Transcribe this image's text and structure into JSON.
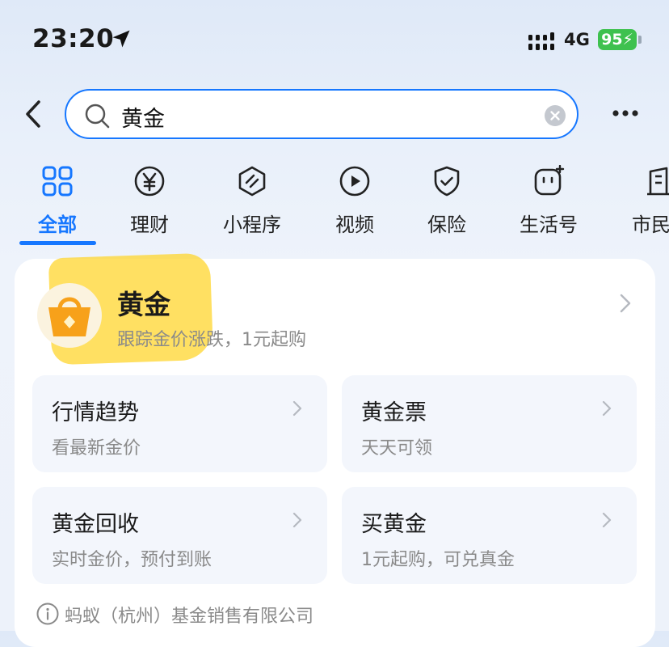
{
  "status_bar": {
    "time": "23:20",
    "network": "4G",
    "battery": "95"
  },
  "search": {
    "query": "黄金"
  },
  "tabs": [
    {
      "label": "全部",
      "icon": "grid-icon",
      "active": true
    },
    {
      "label": "理财",
      "icon": "yen-coin-icon"
    },
    {
      "label": "小程序",
      "icon": "mini-program-icon"
    },
    {
      "label": "视频",
      "icon": "play-icon"
    },
    {
      "label": "保险",
      "icon": "shield-check-icon"
    },
    {
      "label": "生活号",
      "icon": "life-account-icon"
    },
    {
      "label": "市民",
      "icon": "building-icon"
    }
  ],
  "product": {
    "title": "黄金",
    "subtitle": "跟踪金价涨跌，1元起购",
    "logo_icon": "gold-basket-icon",
    "accent_color": "#f7a11a"
  },
  "tiles": [
    {
      "title": "行情趋势",
      "subtitle": "看最新金价"
    },
    {
      "title": "黄金票",
      "subtitle": "天天可领"
    },
    {
      "title": "黄金回收",
      "subtitle": "实时金价，预付到账"
    },
    {
      "title": "买黄金",
      "subtitle": "1元起购，可兑真金"
    }
  ],
  "footer": {
    "provider": "蚂蚁（杭州）基金销售有限公司"
  },
  "colors": {
    "primary": "#1677ff",
    "highlight": "#ffd426",
    "battery": "#3ec14f"
  }
}
